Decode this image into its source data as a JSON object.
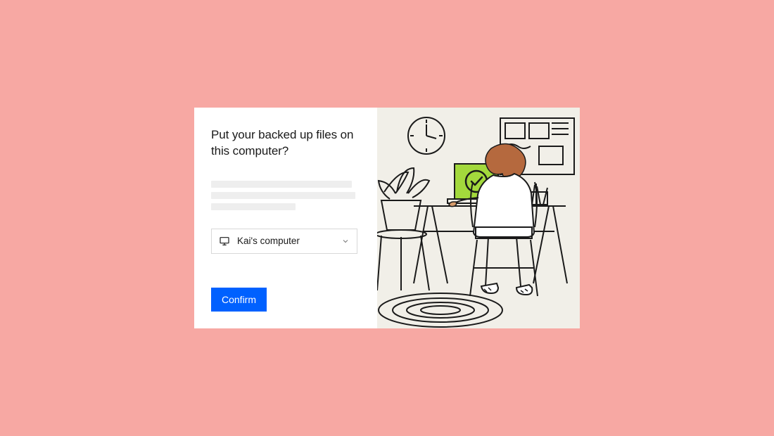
{
  "dialog": {
    "title": "Put your backed up files on this computer?",
    "select": {
      "value": "Kai's computer"
    },
    "confirm_label": "Confirm"
  },
  "colors": {
    "page_bg": "#f7a8a3",
    "accent": "#0061ff",
    "illustration_bg": "#f1efe8",
    "screen_green": "#a3d93c"
  },
  "icons": {
    "monitor": "monitor-icon",
    "chevron_down": "chevron-down-icon",
    "checkmark": "checkmark-icon"
  }
}
